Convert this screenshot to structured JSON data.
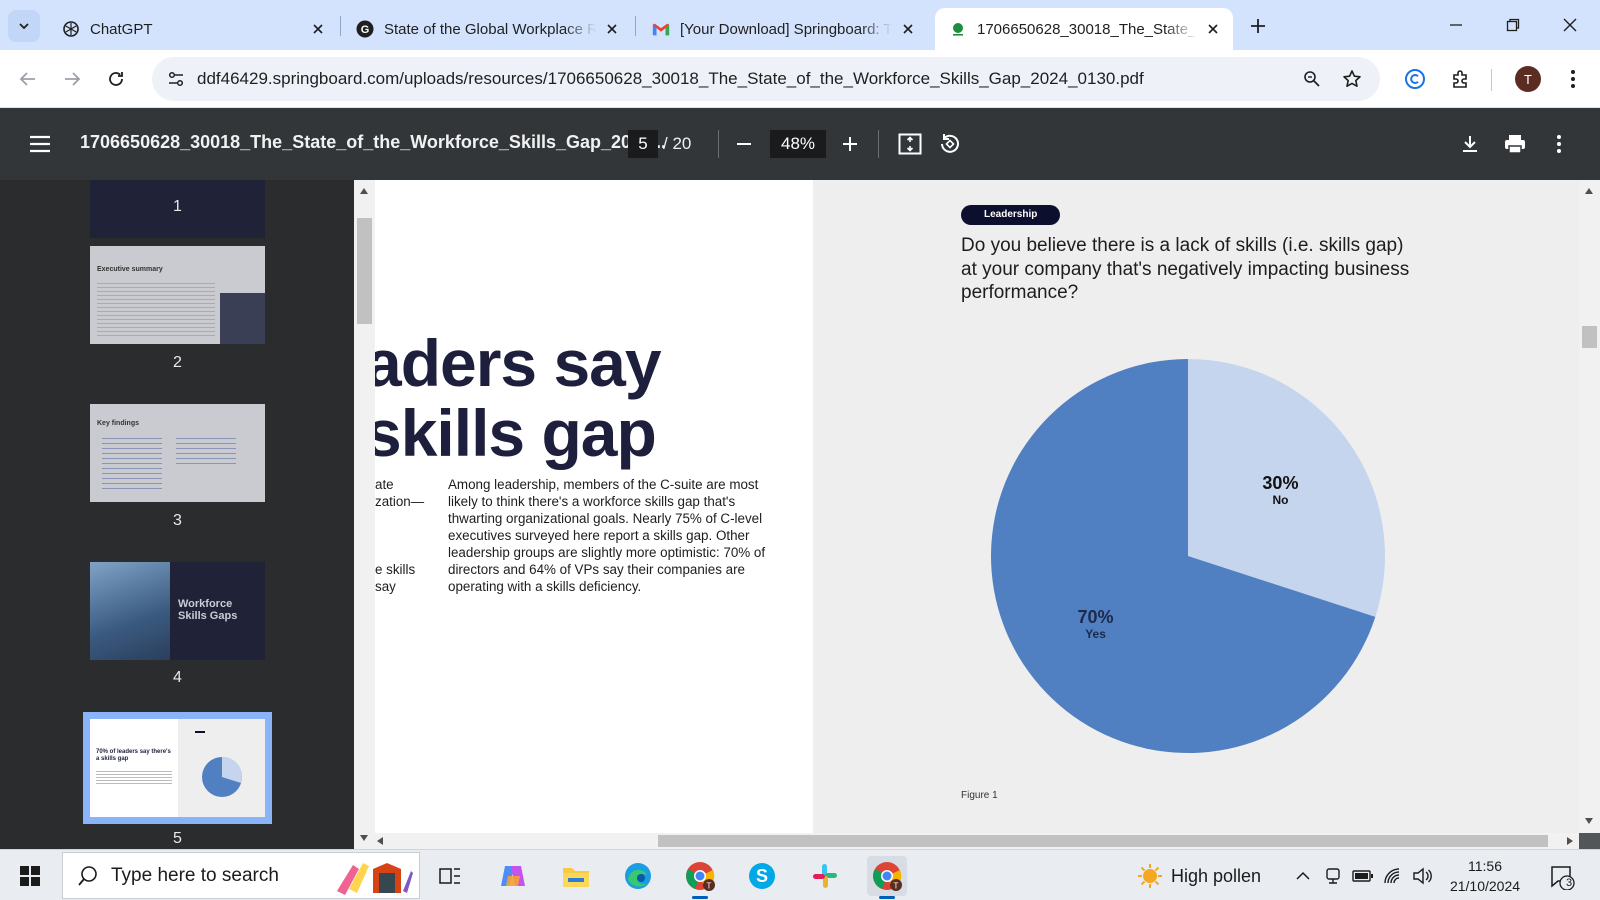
{
  "browser": {
    "tabs": [
      {
        "title": "ChatGPT",
        "icon": "chatgpt-icon"
      },
      {
        "title": "State of the Global Workplace R",
        "icon": "gallup-icon"
      },
      {
        "title": "[Your Download] Springboard: T",
        "icon": "gmail-icon"
      },
      {
        "title": "1706650628_30018_The_State_o",
        "icon": "pdf-dot-icon",
        "active": true
      }
    ],
    "address": "ddf46429.springboard.com/uploads/resources/1706650628_30018_The_State_of_the_Workforce_Skills_Gap_2024_0130.pdf",
    "profile_initial": "T"
  },
  "pdf_toolbar": {
    "title": "1706650628_30018_The_State_of_the_Workforce_Skills_Gap_2024...",
    "current_page": "5",
    "total_pages": "/ 20",
    "zoom": "48%"
  },
  "thumbnails": [
    {
      "num": "1"
    },
    {
      "num": "2",
      "heading": "Executive summary"
    },
    {
      "num": "3",
      "heading": "Key findings"
    },
    {
      "num": "4",
      "heading": "Workforce Skills Gaps"
    },
    {
      "num": "5",
      "heading": "70% of leaders say there's a skills gap",
      "selected": true
    }
  ],
  "document": {
    "headline_line1": "aders say",
    "headline_line2": "skills gap",
    "left_fragments": [
      "ate",
      "zation—",
      "e skills",
      "say"
    ],
    "body": "Among leadership, members of the C-suite are most likely to think there's a workforce skills gap that's thwarting organizational goals. Nearly 75% of C-level executives surveyed here report a skills gap. Other leadership groups are slightly more optimistic: 70% of directors and 64% of VPs say their companies are operating with a skills deficiency.",
    "badge": "Leadership",
    "question": "Do you believe there is a lack of skills (i.e. skills gap) at your company that's negatively impacting business performance?",
    "figure_caption": "Figure 1"
  },
  "chart_data": {
    "type": "pie",
    "title": "",
    "slices": [
      {
        "label": "No",
        "value": 30,
        "display": "30%",
        "color": "#c5d5ee"
      },
      {
        "label": "Yes",
        "value": 70,
        "display": "70%",
        "color": "#5180c2"
      }
    ]
  },
  "taskbar": {
    "search_placeholder": "Type here to search",
    "weather_text": "High pollen",
    "time": "11:56",
    "date": "21/10/2024",
    "notification_count": "3"
  }
}
